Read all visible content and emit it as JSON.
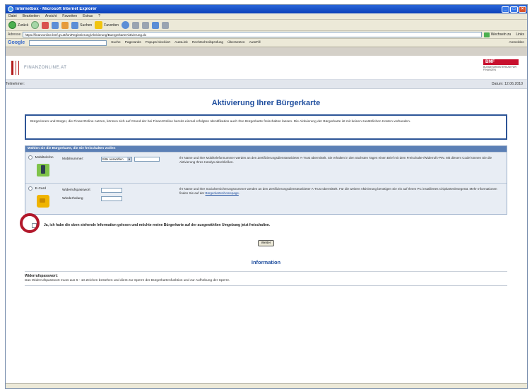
{
  "window": {
    "title": "Internetbox - Microsoft Internet Explorer"
  },
  "menu": [
    "Datei",
    "Bearbeiten",
    "Ansicht",
    "Favoriten",
    "Extras",
    "?"
  ],
  "toolbar": {
    "back": "Zurück",
    "search": "Suchen",
    "favorites": "Favoriten"
  },
  "address": {
    "label": "Adresse",
    "url": "https://finanzonline.bmf.gv.at/fon/Registrierung/Aktivierung/BuergerkarteAktivierung.do",
    "go": "Wechseln zu",
    "links": "Links"
  },
  "google": {
    "logo": "Google",
    "items": [
      "Suche",
      "Pageranks",
      "Popups blockiert",
      "AutoLink",
      "Rechtschreibprüfung",
      "Übersetzen",
      "AutoFill"
    ],
    "right": "Anmelden"
  },
  "site": {
    "logo": "FINANZONLINE.AT",
    "bmf": "BMF",
    "bmf_sub": "BUNDESMINISTERIUM FÜR FINANZEN",
    "user_label": "Teilnehmer:",
    "date": "Datum: 12.06.2010"
  },
  "page": {
    "heading": "Aktivierung Ihrer Bürgerkarte",
    "notice": "Bürgerinnen und Bürger, die FinanzOnline nutzen, können sich auf Grund der bei FinanzOnline bereits einmal erfolgten Identifikation auch Ihre Bürgerkarte freischalten lassen. Die Aktivierung der Bürgerkarte ist mit keinen zusätzlichen Kosten verbunden.",
    "select_head": "Wählen sie die Bürgerkarte, die Sie freischalten wollen",
    "options": [
      {
        "label": "Mobiltelefon",
        "icon": "mobile-phone-icon",
        "field1_label": "Mobilnummer:",
        "select_value": "Bitte auswählen",
        "text": "Ihr Name und Ihre Mobiltelefonnummer werden an den Zertifizierungsdiensteanbieter A-Trust übermittelt. Sie erhalten in den nächsten Tagen einen Brief mit dem Freischalte-/Widerrufs-PIN. Mit diesem Code können Sie die Aktivierung Ihres Handys abschließen."
      },
      {
        "label": "E-Card",
        "icon": "ecard-icon",
        "field1_label": "Widerrufspasswort",
        "field2_label": "Wiederholung",
        "text": "Ihr Name und Ihre Sozialversicherungsnummer werden an den Zertifizierungsdiensteanbieter A-Trust übermittelt. Für die weitere Aktivierung benötigen Sie ein auf Ihrem PC installiertes Chipkartenlesegerät. Mehr Informationen finden Sie auf der",
        "link": "Bürgerkartenhomepage",
        "text_end": "."
      }
    ],
    "confirm": "Ja, ich habe die oben stehende Information gelesen und möchte meine Bürgerkarte auf der ausgewählten Umgebung jetzt freischalten.",
    "weiter": "Weiter",
    "info_heading": "Information",
    "info_title": "Widerrufspasswort:",
    "info_text": "Das Widerrufspasswort muss aus 6 - 10 Zeichen bestehen und dient zur Sperre der Bürgerkartenfunktion und zur Aufhebung der Sperre."
  }
}
